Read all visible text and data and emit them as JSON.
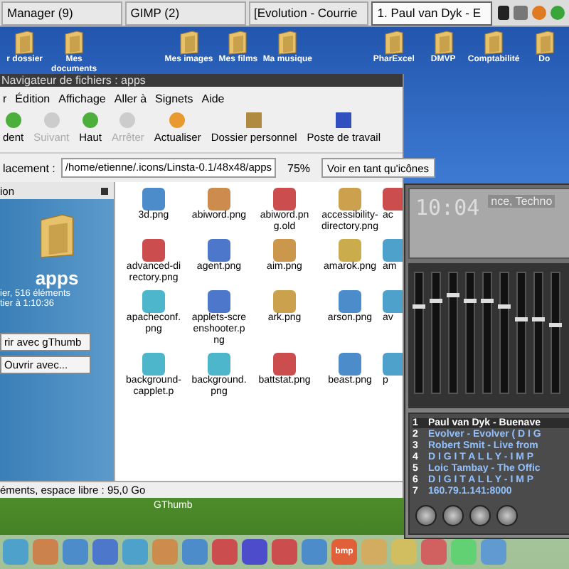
{
  "taskbar": {
    "tasks": [
      {
        "label": "Manager (9)",
        "selected": false
      },
      {
        "label": "GIMP (2)",
        "selected": false
      },
      {
        "label": "[Evolution - Courrie",
        "selected": false
      },
      {
        "label": "1. Paul van Dyk - E",
        "selected": true
      }
    ]
  },
  "desktop_icons": [
    "r dossier",
    "Mes documents",
    "Mes images",
    "Mes films",
    "Ma musique",
    "PharExcel",
    "DMVP",
    "Comptabilité",
    "Do"
  ],
  "window": {
    "title": "Navigateur de fichiers : apps",
    "menus": [
      "r",
      "Édition",
      "Affichage",
      "Aller à",
      "Signets",
      "Aide"
    ],
    "toolbar": [
      {
        "label": "dent",
        "disabled": false
      },
      {
        "label": "Suivant",
        "disabled": true
      },
      {
        "label": "Haut",
        "disabled": false
      },
      {
        "label": "Arrêter",
        "disabled": true
      },
      {
        "label": "Actualiser",
        "disabled": false
      },
      {
        "label": "Dossier personnel",
        "disabled": false
      },
      {
        "label": "Poste de travail",
        "disabled": false
      }
    ],
    "location": {
      "label": "lacement :",
      "value": "/home/etienne/.icons/Linsta-0.1/48x48/apps",
      "zoom": "75%",
      "view": "Voir en tant qu'icônes"
    },
    "sidebar": {
      "header": "ion",
      "title": "apps",
      "info": [
        "ier, 516 éléments",
        "tier à 1:10:36"
      ],
      "buttons": [
        "rir avec gThumb",
        "Ouvrir avec..."
      ]
    },
    "files": [
      "3d.png",
      "abiword.png",
      "abiword.png.old",
      "accessibility-directory.png",
      "ac",
      "advanced-directory.png",
      "agent.png",
      "aim.png",
      "amarok.png",
      "am",
      "apacheconf.png",
      "applets-screenshooter.png",
      "ark.png",
      "arson.png",
      "av",
      "background-capplet.p",
      "background.png",
      "battstat.png",
      "beast.png",
      "p"
    ],
    "status": "éments, espace libre : 95,0 Go"
  },
  "dock_label": "GThumb",
  "dock_badge": "bmp",
  "player": {
    "time": "10:04",
    "ticker": "nce, Techno",
    "equalizer": [
      {
        "level": 0.7
      },
      {
        "level": 0.75
      },
      {
        "level": 0.8
      },
      {
        "level": 0.75
      },
      {
        "level": 0.75
      },
      {
        "level": 0.7
      },
      {
        "level": 0.6
      },
      {
        "level": 0.6
      },
      {
        "level": 0.55
      }
    ],
    "playlist": [
      {
        "number": "1",
        "title": "Paul van Dyk - Buenave",
        "selected": true
      },
      {
        "number": "2",
        "title": "Evolver - Evolver ( D I G",
        "selected": false
      },
      {
        "number": "3",
        "title": "Robert Smit - Live from",
        "selected": false
      },
      {
        "number": "4",
        "title": "D I G I T A L L Y - I M P",
        "selected": false
      },
      {
        "number": "5",
        "title": "Loic Tambay - The Offic",
        "selected": false
      },
      {
        "number": "6",
        "title": "D I G I T A L L Y - I M P",
        "selected": false
      },
      {
        "number": "7",
        "title": "160.79.1.141:8000",
        "selected": false
      }
    ]
  }
}
